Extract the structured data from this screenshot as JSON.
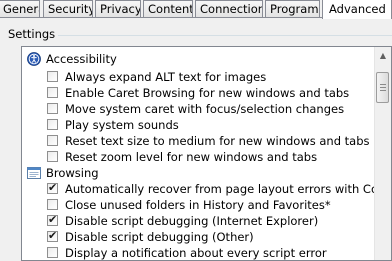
{
  "tabs": [
    {
      "label": "General",
      "active": false
    },
    {
      "label": "Security",
      "active": false
    },
    {
      "label": "Privacy",
      "active": false
    },
    {
      "label": "Content",
      "active": false
    },
    {
      "label": "Connections",
      "active": false
    },
    {
      "label": "Programs",
      "active": false
    },
    {
      "label": "Advanced",
      "active": true
    }
  ],
  "settings": {
    "group_label": "Settings",
    "categories": [
      {
        "label": "Accessibility",
        "icon": "accessibility-icon"
      },
      {
        "label": "Browsing",
        "icon": "browsing-icon"
      }
    ],
    "items": [
      {
        "label": "Always expand ALT text for images",
        "checked": false
      },
      {
        "label": "Enable Caret Browsing for new windows and tabs",
        "checked": false
      },
      {
        "label": "Move system caret with focus/selection changes",
        "checked": false
      },
      {
        "label": "Play system sounds",
        "checked": false
      },
      {
        "label": "Reset text size to medium for new windows and tabs",
        "checked": false
      },
      {
        "label": "Reset zoom level for new windows and tabs",
        "checked": false
      },
      {
        "label": "Automatically recover from page layout errors with Compa",
        "checked": true
      },
      {
        "label": "Close unused folders in History and Favorites*",
        "checked": false
      },
      {
        "label": "Disable script debugging (Internet Explorer)",
        "checked": true
      },
      {
        "label": "Disable script debugging (Other)",
        "checked": true
      },
      {
        "label": "Display a notification about every script error",
        "checked": false
      }
    ],
    "check_glyph": "✔"
  },
  "scrollbar": {
    "up_arrow": "▲"
  }
}
